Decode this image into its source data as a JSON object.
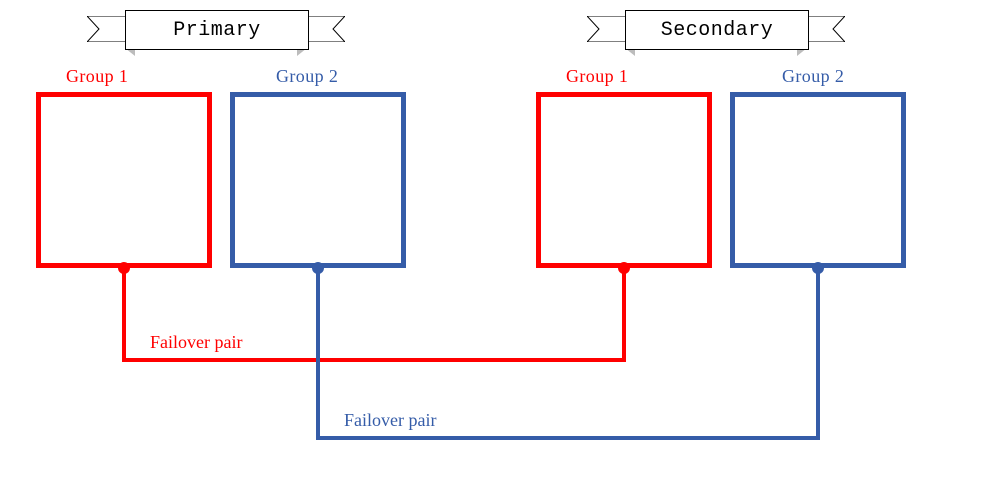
{
  "sites": [
    {
      "key": "primary",
      "title": "Primary"
    },
    {
      "key": "secondary",
      "title": "Secondary"
    }
  ],
  "groups": {
    "primary": {
      "group1": "Group 1",
      "group2": "Group 2"
    },
    "secondary": {
      "group1": "Group 1",
      "group2": "Group 2"
    }
  },
  "links": [
    {
      "color": "red",
      "label": "Failover pair",
      "from": "primary.group1",
      "to": "secondary.group1"
    },
    {
      "color": "blue",
      "label": "Failover pair",
      "from": "primary.group2",
      "to": "secondary.group2"
    }
  ],
  "colors": {
    "red": "#ff0000",
    "blue": "#355ca8"
  }
}
